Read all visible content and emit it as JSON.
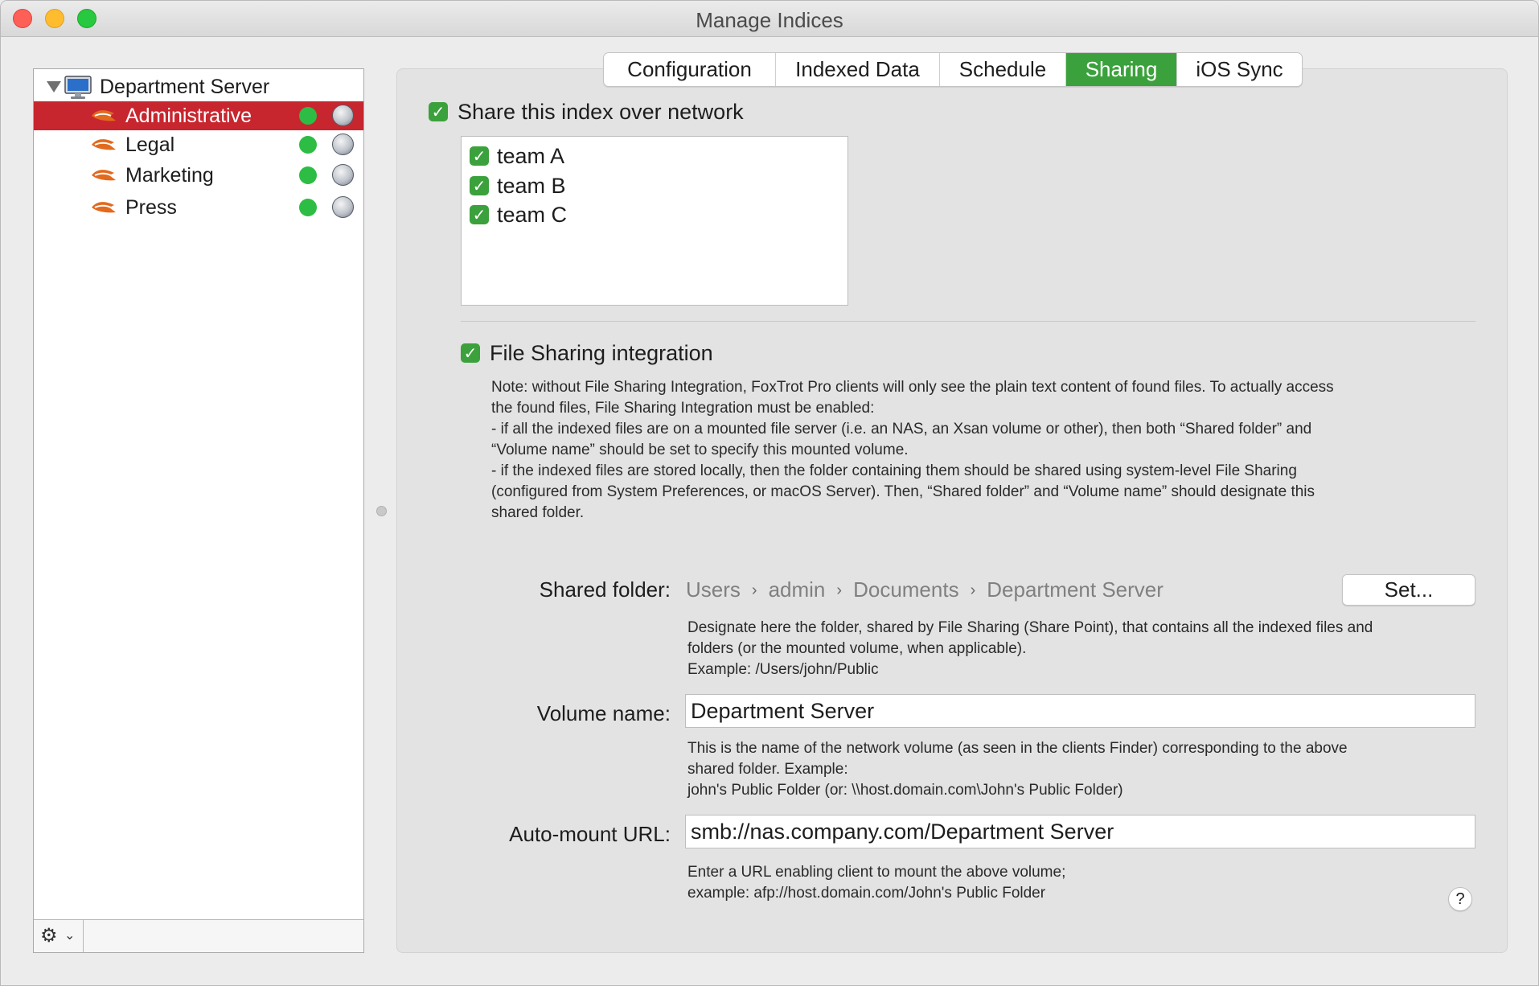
{
  "window": {
    "title": "Manage Indices"
  },
  "sidebar": {
    "root": {
      "label": "Department Server",
      "icon": "monitor-icon"
    },
    "items": [
      {
        "label": "Administrative",
        "selected": true,
        "status": "green"
      },
      {
        "label": "Legal",
        "selected": false,
        "status": "green"
      },
      {
        "label": "Marketing",
        "selected": false,
        "status": "green"
      },
      {
        "label": "Press",
        "selected": false,
        "status": "green"
      }
    ],
    "footer": {
      "gear_glyph": "⚙",
      "chevron_glyph": "⌄"
    }
  },
  "tabs": [
    {
      "label": "Configuration",
      "active": false
    },
    {
      "label": "Indexed Data",
      "active": false
    },
    {
      "label": "Schedule",
      "active": false
    },
    {
      "label": "Sharing",
      "active": true
    },
    {
      "label": "iOS Sync",
      "active": false
    }
  ],
  "sharing": {
    "share_checkbox": {
      "label": "Share this index over network",
      "checked": true
    },
    "teams": [
      {
        "label": "team A",
        "checked": true
      },
      {
        "label": "team B",
        "checked": true
      },
      {
        "label": "team C",
        "checked": true
      }
    ],
    "file_sharing_checkbox": {
      "label": "File Sharing integration",
      "checked": true
    },
    "note_lines": [
      "Note: without File Sharing Integration, FoxTrot Pro clients will only see the plain text content of found files. To actually access",
      "the found files, File Sharing Integration must be enabled:",
      "- if all the indexed files are on a mounted file server (i.e. an NAS, an Xsan volume or other), then both “Shared folder” and",
      "“Volume name” should be set to specify this mounted volume.",
      "- if the indexed files are stored locally, then the folder containing them should be shared using system-level File Sharing",
      "(configured from System Preferences, or macOS Server). Then, “Shared folder” and “Volume name” should designate this",
      "shared folder."
    ],
    "shared_folder": {
      "label": "Shared folder:",
      "path": [
        "Users",
        "admin",
        "Documents",
        "Department Server"
      ],
      "separator": "›",
      "set_button": "Set...",
      "help_lines": [
        "Designate here the folder, shared by File Sharing (Share Point), that contains all the indexed files and",
        "folders (or the mounted volume, when applicable).",
        "Example: /Users/john/Public"
      ]
    },
    "volume_name": {
      "label": "Volume name:",
      "value": "Department Server",
      "help_lines": [
        "This is the name of the network volume (as seen in the clients Finder) corresponding to the above",
        "shared folder. Example:",
        "john's Public Folder (or: \\\\host.domain.com\\John's Public Folder)"
      ]
    },
    "auto_mount": {
      "label": "Auto-mount URL:",
      "value": "smb://nas.company.com/Department Server",
      "help_lines": [
        "Enter a URL enabling client to mount the above volume;",
        "example: afp://host.domain.com/John's Public Folder"
      ]
    },
    "help_button": "?"
  },
  "colors": {
    "accent_green": "#3ba13c",
    "selection_red": "#c8262f",
    "status_green": "#2dbd44"
  }
}
